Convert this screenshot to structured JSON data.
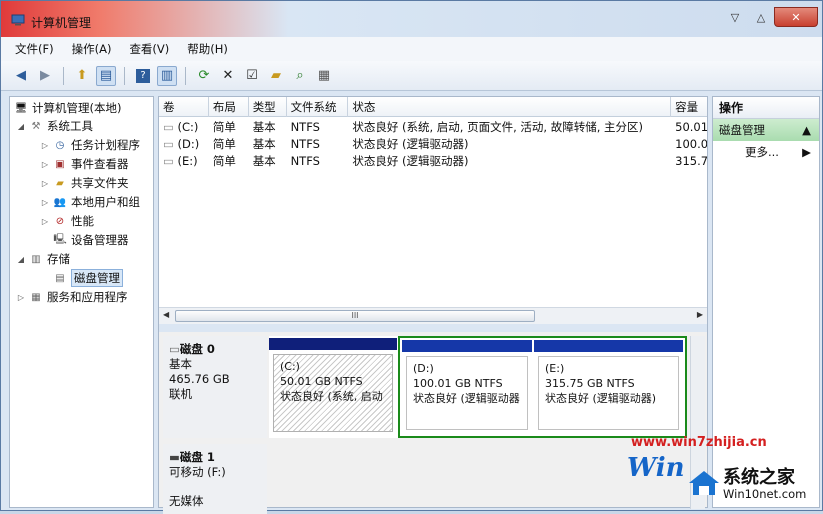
{
  "window": {
    "title": "计算机管理"
  },
  "menu": [
    "文件(F)",
    "操作(A)",
    "查看(V)",
    "帮助(H)"
  ],
  "tree": {
    "root": "计算机管理(本地)",
    "system_tools": "系统工具",
    "task_scheduler": "任务计划程序",
    "event_viewer": "事件查看器",
    "shared_folders": "共享文件夹",
    "local_users": "本地用户和组",
    "performance": "性能",
    "device_manager": "设备管理器",
    "storage": "存储",
    "disk_management": "磁盘管理",
    "services": "服务和应用程序"
  },
  "table": {
    "columns": [
      "卷",
      "布局",
      "类型",
      "文件系统",
      "状态",
      "容量"
    ],
    "rows": [
      {
        "vol": "(C:)",
        "layout": "简单",
        "type": "基本",
        "fs": "NTFS",
        "status": "状态良好 (系统, 启动, 页面文件, 活动, 故障转储, 主分区)",
        "cap": "50.01"
      },
      {
        "vol": "(D:)",
        "layout": "简单",
        "type": "基本",
        "fs": "NTFS",
        "status": "状态良好 (逻辑驱动器)",
        "cap": "100.0"
      },
      {
        "vol": "(E:)",
        "layout": "简单",
        "type": "基本",
        "fs": "NTFS",
        "status": "状态良好 (逻辑驱动器)",
        "cap": "315.7"
      }
    ],
    "scroll_thumb": "III"
  },
  "disk0": {
    "name": "磁盘 0",
    "type": "基本",
    "size": "465.76 GB",
    "state": "联机",
    "parts": [
      {
        "label": "(C:)",
        "size": "50.01 GB NTFS",
        "status": "状态良好 (系统, 启动"
      },
      {
        "label": "(D:)",
        "size": "100.01 GB NTFS",
        "status": "状态良好 (逻辑驱动器"
      },
      {
        "label": "(E:)",
        "size": "315.75 GB NTFS",
        "status": "状态良好 (逻辑驱动器)"
      }
    ]
  },
  "disk1": {
    "name": "磁盘 1",
    "type": "可移动 (F:)",
    "state": "无媒体"
  },
  "actions": {
    "header": "操作",
    "section": "磁盘管理",
    "more": "更多..."
  },
  "watermark": {
    "url": "www.win7zhijia.cn",
    "logo_big": "Win",
    "logo_cn": "系统之家",
    "logo_url": "Win10net.com"
  },
  "colors": {
    "primary_partition": "#0f1f7a",
    "logical_partition": "#1537a8",
    "extended_border": "#1a8a1a",
    "actions_section": "#a9dcaf"
  }
}
